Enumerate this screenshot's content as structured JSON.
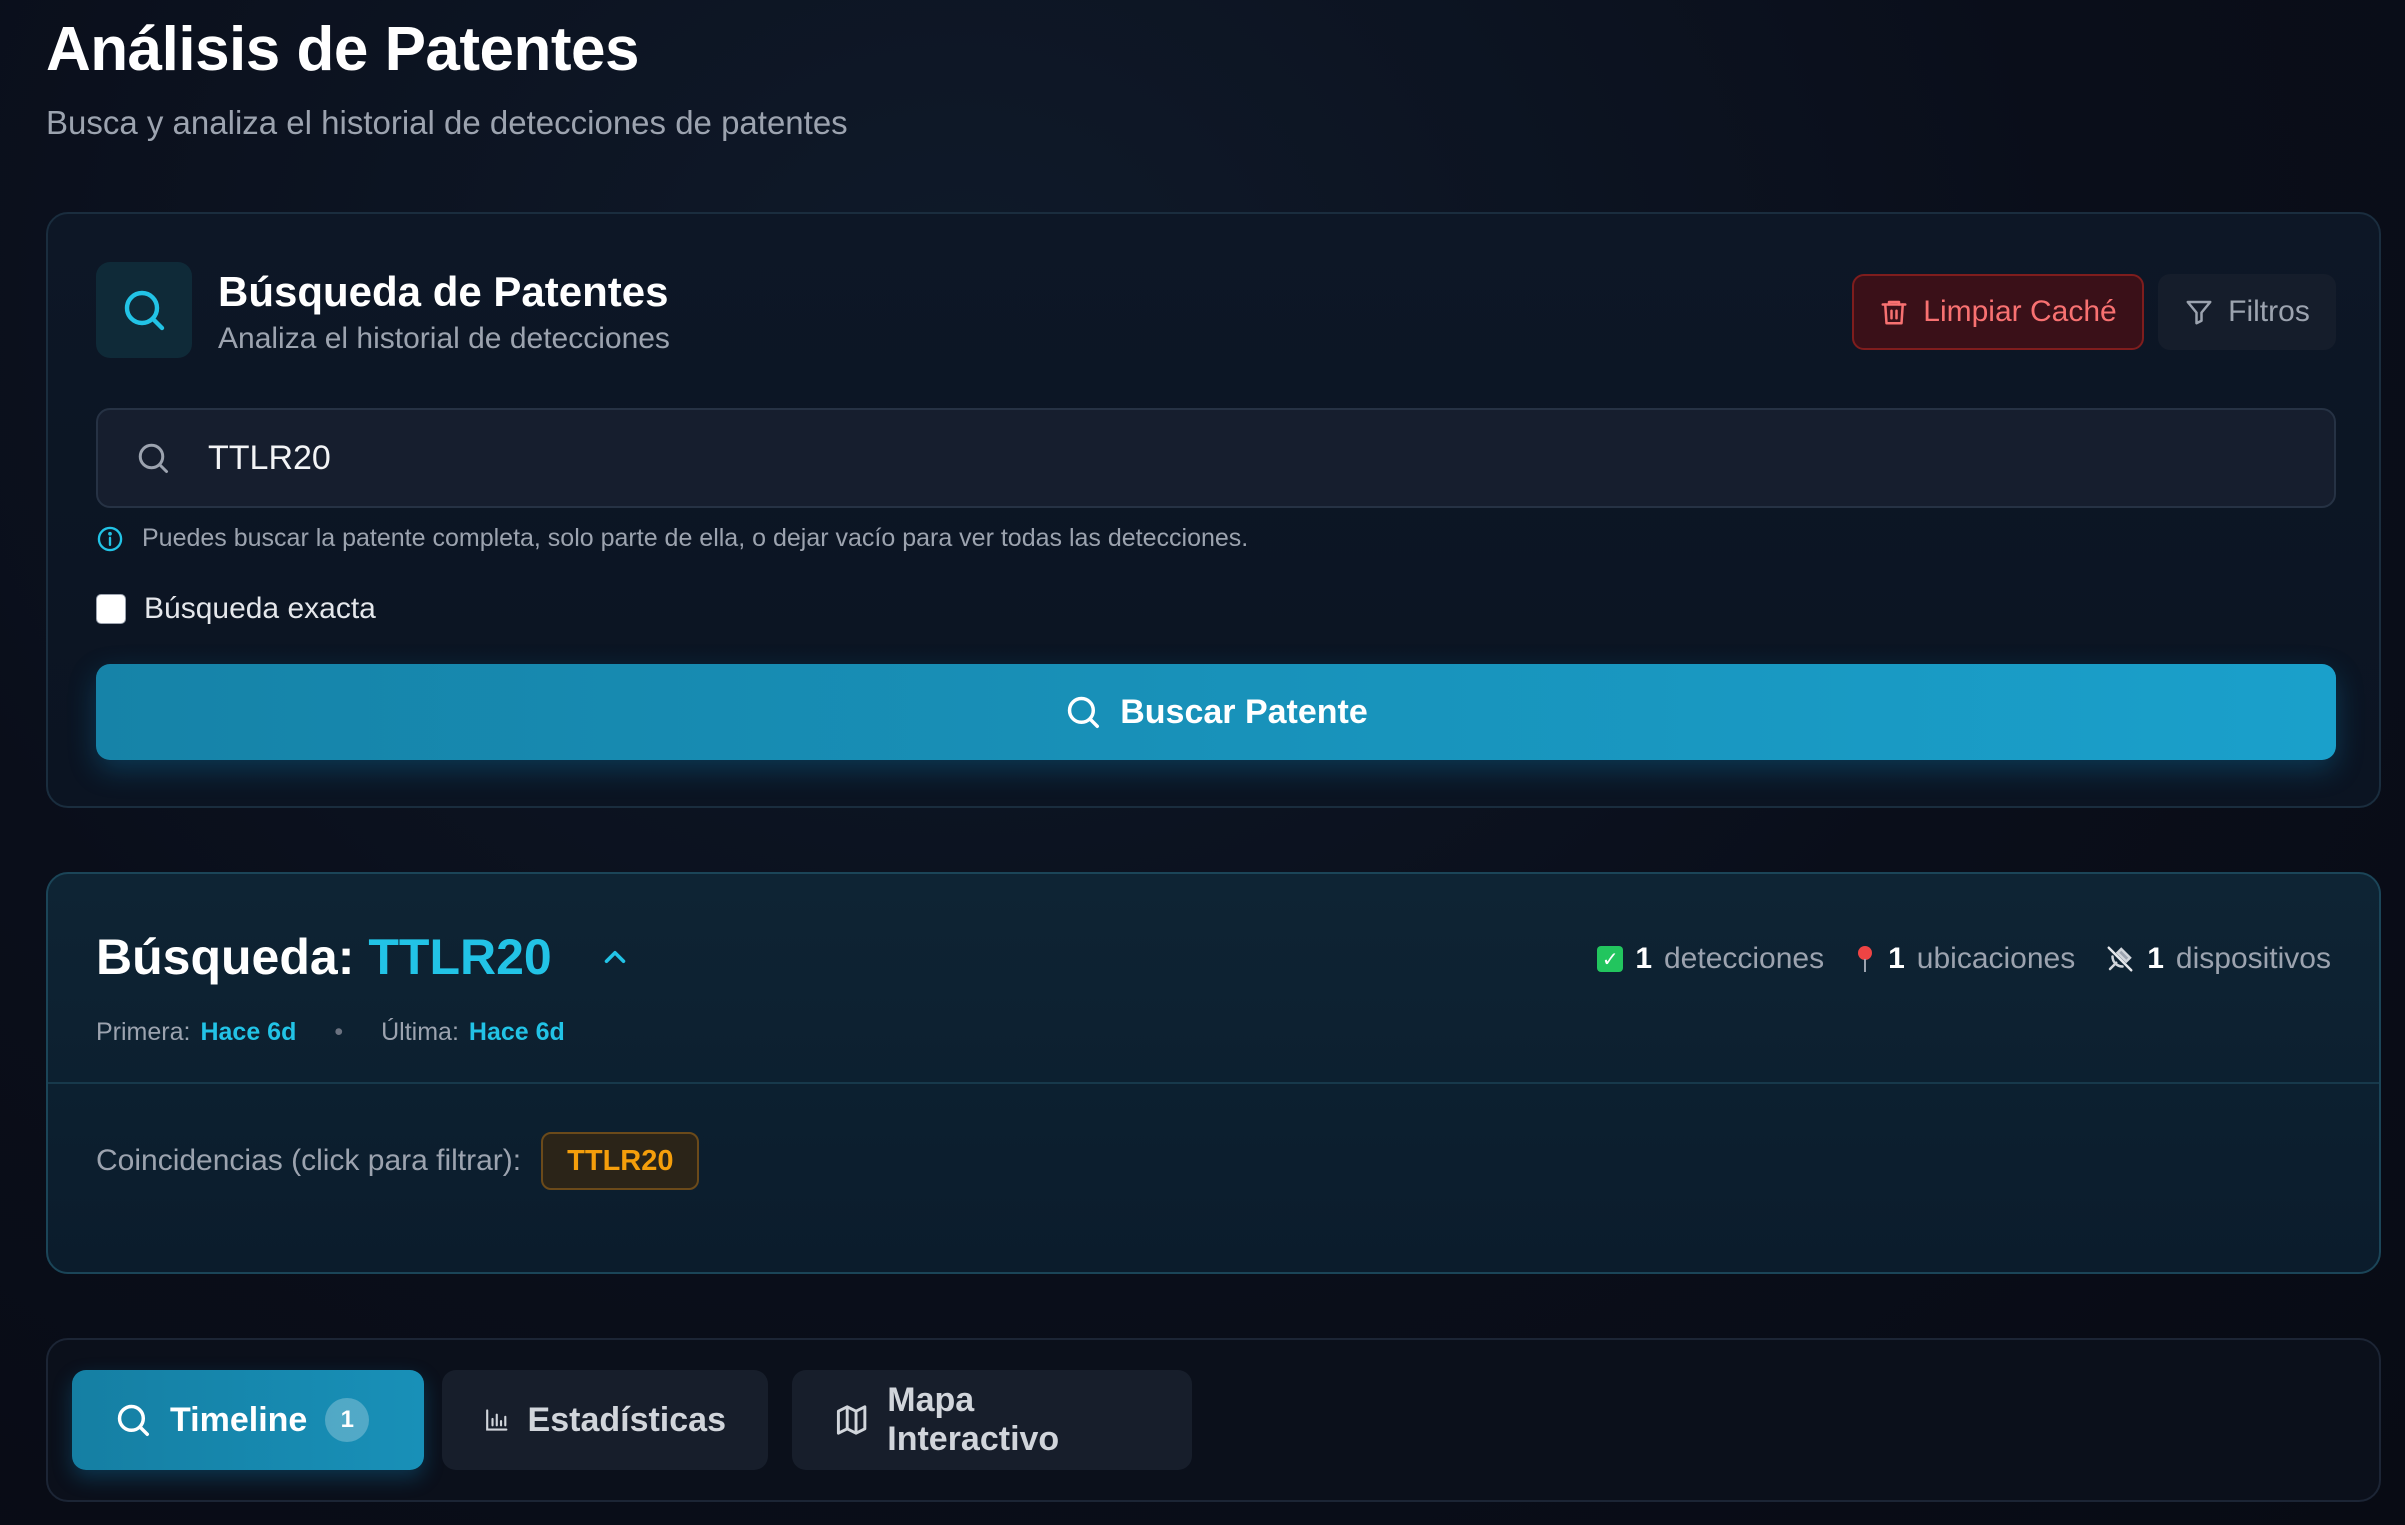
{
  "header": {
    "title": "Análisis de Patentes",
    "subtitle": "Busca y analiza el historial de detecciones de patentes"
  },
  "search_card": {
    "title": "Búsqueda de Patentes",
    "subtitle": "Analiza el historial de detecciones",
    "clear_cache_label": "Limpiar Caché",
    "filters_label": "Filtros",
    "input_value": "TTLR20",
    "hint": "Puedes buscar la patente completa, solo parte de ella, o dejar vacío para ver todas las detecciones.",
    "exact_label": "Búsqueda exacta",
    "exact_checked": false,
    "search_button_label": "Buscar Patente"
  },
  "results": {
    "title_prefix": "Búsqueda:",
    "query": "TTLR20",
    "stats": {
      "detections_count": "1",
      "detections_label": "detecciones",
      "locations_count": "1",
      "locations_label": "ubicaciones",
      "devices_count": "1",
      "devices_label": "dispositivos"
    },
    "first_label": "Primera:",
    "first_value": "Hace 6d",
    "last_label": "Última:",
    "last_value": "Hace 6d",
    "matches_label": "Coincidencias (click para filtrar):",
    "matches": [
      "TTLR20"
    ]
  },
  "tabs": {
    "timeline_label": "Timeline",
    "timeline_badge": "1",
    "stats_label": "Estadísticas",
    "map_label": "Mapa Interactivo"
  },
  "colors": {
    "accent": "#22c3e6",
    "primary_button": "#1aa0cb",
    "danger": "#f87171",
    "match_chip": "#f59e0b",
    "background": "#0a0e1a"
  }
}
